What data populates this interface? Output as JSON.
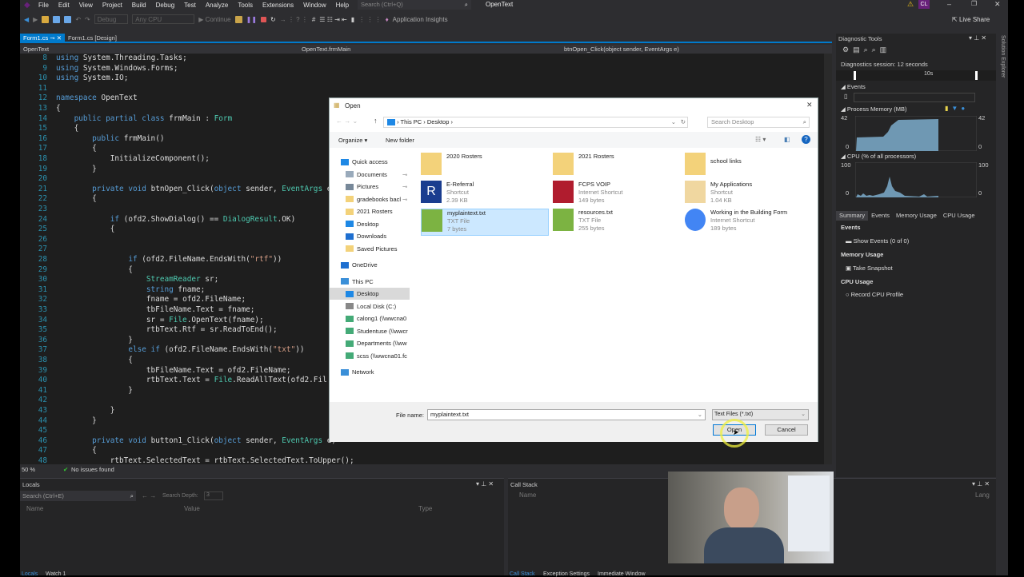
{
  "menu": [
    "File",
    "Edit",
    "View",
    "Project",
    "Build",
    "Debug",
    "Test",
    "Analyze",
    "Tools",
    "Extensions",
    "Window",
    "Help"
  ],
  "search_placeholder": "Search (Ctrl+Q)",
  "solution_name": "OpenText",
  "user_initials": "CL",
  "toolbar": {
    "config": "Debug",
    "platform": "Any CPU",
    "continue": "Continue",
    "app_insights": "Application Insights",
    "live_share": "Live Share"
  },
  "tabs": [
    {
      "label": "Form1.cs",
      "active": true
    },
    {
      "label": "Form1.cs [Design]",
      "active": false
    }
  ],
  "navbar": {
    "project": "OpenText",
    "class": "OpenText.frmMain",
    "member": "btnOpen_Click(object sender, EventArgs e)"
  },
  "code": [
    {
      "n": "8",
      "t": "using System.Threading.Tasks;"
    },
    {
      "n": "9",
      "t": "using System.Windows.Forms;"
    },
    {
      "n": "10",
      "t": "using System.IO;"
    },
    {
      "n": "11",
      "t": ""
    },
    {
      "n": "12",
      "t": "namespace OpenText"
    },
    {
      "n": "13",
      "t": "{"
    },
    {
      "n": "14",
      "t": "    public partial class frmMain : Form"
    },
    {
      "n": "15",
      "t": "    {"
    },
    {
      "n": "16",
      "t": "        public frmMain()"
    },
    {
      "n": "17",
      "t": "        {"
    },
    {
      "n": "18",
      "t": "            InitializeComponent();"
    },
    {
      "n": "19",
      "t": "        }"
    },
    {
      "n": "20",
      "t": ""
    },
    {
      "n": "21",
      "t": "        private void btnOpen_Click(object sender, EventArgs e)"
    },
    {
      "n": "22",
      "t": "        {"
    },
    {
      "n": "23",
      "t": ""
    },
    {
      "n": "24",
      "t": "            if (ofd2.ShowDialog() == DialogResult.OK)"
    },
    {
      "n": "25",
      "t": "            {"
    },
    {
      "n": "26",
      "t": ""
    },
    {
      "n": "27",
      "t": ""
    },
    {
      "n": "28",
      "t": "                if (ofd2.FileName.EndsWith(\"rtf\"))"
    },
    {
      "n": "29",
      "t": "                {"
    },
    {
      "n": "30",
      "t": "                    StreamReader sr;"
    },
    {
      "n": "31",
      "t": "                    string fname;"
    },
    {
      "n": "32",
      "t": "                    fname = ofd2.FileName;"
    },
    {
      "n": "33",
      "t": "                    tbFileName.Text = fname;"
    },
    {
      "n": "34",
      "t": "                    sr = File.OpenText(fname);"
    },
    {
      "n": "35",
      "t": "                    rtbText.Rtf = sr.ReadToEnd();"
    },
    {
      "n": "36",
      "t": "                }"
    },
    {
      "n": "37",
      "t": "                else if (ofd2.FileName.EndsWith(\"txt\"))"
    },
    {
      "n": "38",
      "t": "                {"
    },
    {
      "n": "39",
      "t": "                    tbFileName.Text = ofd2.FileName;"
    },
    {
      "n": "40",
      "t": "                    rtbText.Text = File.ReadAllText(ofd2.Fil"
    },
    {
      "n": "41",
      "t": "                }"
    },
    {
      "n": "42",
      "t": ""
    },
    {
      "n": "43",
      "t": "            }"
    },
    {
      "n": "44",
      "t": "        }"
    },
    {
      "n": "45",
      "t": ""
    },
    {
      "n": "46",
      "t": "        private void button1_Click(object sender, EventArgs e)"
    },
    {
      "n": "47",
      "t": "        {"
    },
    {
      "n": "48",
      "t": "            rtbText.SelectedText = rtbText.SelectedText.ToUpper();"
    }
  ],
  "status": {
    "zoom": "50 %",
    "issues": "No issues found"
  },
  "locals": {
    "title": "Locals",
    "search_placeholder": "Search (Ctrl+E)",
    "search_depth_label": "Search Depth:",
    "search_depth": "3",
    "columns": [
      "Name",
      "Value",
      "Type"
    ],
    "tabs": [
      "Locals",
      "Watch 1"
    ]
  },
  "callstack": {
    "title": "Call Stack",
    "columns": [
      "Name",
      "Lang"
    ],
    "tabs": [
      "Call Stack",
      "Exception Settings",
      "Immediate Window"
    ]
  },
  "diag": {
    "title": "Diagnostic Tools",
    "session": "Diagnostics session: 12 seconds",
    "timeline": "10s",
    "events": "Events",
    "memory": "Process Memory (MB)",
    "mem_max": "42",
    "mem_min": "0",
    "cpu": "CPU (% of all processors)",
    "cpu_max": "100",
    "cpu_min": "0",
    "tabs": [
      "Summary",
      "Events",
      "Memory Usage",
      "CPU Usage"
    ],
    "sections": [
      {
        "title": "Events",
        "action": "Show Events (0 of 0)"
      },
      {
        "title": "Memory Usage",
        "action": "Take Snapshot"
      },
      {
        "title": "CPU Usage",
        "action": "Record CPU Profile"
      }
    ]
  },
  "solution_explorer": "Solution Explorer",
  "dialog": {
    "title": "Open",
    "breadcrumb": [
      "This PC",
      "Desktop"
    ],
    "search_placeholder": "Search Desktop",
    "organize": "Organize",
    "new_folder": "New folder",
    "nav": [
      {
        "label": "Quick access",
        "level": 0,
        "icon": "star"
      },
      {
        "label": "Documents",
        "level": 1,
        "icon": "doc",
        "pin": true
      },
      {
        "label": "Pictures",
        "level": 1,
        "icon": "pic",
        "pin": true
      },
      {
        "label": "gradebooks bacl",
        "level": 1,
        "icon": "folder",
        "pin": true
      },
      {
        "label": "2021 Rosters",
        "level": 1,
        "icon": "folder"
      },
      {
        "label": "Desktop",
        "level": 1,
        "icon": "desktop"
      },
      {
        "label": "Downloads",
        "level": 1,
        "icon": "download"
      },
      {
        "label": "Saved Pictures",
        "level": 1,
        "icon": "folder"
      },
      {
        "label": "OneDrive",
        "level": 0,
        "icon": "cloud",
        "gap": true
      },
      {
        "label": "This PC",
        "level": 0,
        "icon": "pc",
        "gap": true
      },
      {
        "label": "Desktop",
        "level": 1,
        "icon": "desktop",
        "selected": true
      },
      {
        "label": "Local Disk (C:)",
        "level": 1,
        "icon": "disk"
      },
      {
        "label": "calong1 (\\\\wwcna0",
        "level": 1,
        "icon": "net"
      },
      {
        "label": "Studentuse (\\\\wwcr",
        "level": 1,
        "icon": "net"
      },
      {
        "label": "Departments (\\\\ww",
        "level": 1,
        "icon": "net"
      },
      {
        "label": "scss (\\\\wwcna01.fc",
        "level": 1,
        "icon": "net"
      },
      {
        "label": "Network",
        "level": 0,
        "icon": "network",
        "gap": true
      }
    ],
    "files": [
      {
        "name": "2020 Rosters",
        "type": "",
        "size": "",
        "icon": "folder-doc"
      },
      {
        "name": "2021 Rosters",
        "type": "",
        "size": "",
        "icon": "folder-doc"
      },
      {
        "name": "school links",
        "type": "",
        "size": "",
        "icon": "folder"
      },
      {
        "name": "E-Referral",
        "type": "Shortcut",
        "size": "2.39 KB",
        "icon": "r-app"
      },
      {
        "name": "FCPS VOIP",
        "type": "Internet Shortcut",
        "size": "149 bytes",
        "icon": "phone"
      },
      {
        "name": "My Applications",
        "type": "Shortcut",
        "size": "1.04 KB",
        "icon": "app"
      },
      {
        "name": "myplaintext.txt",
        "type": "TXT File",
        "size": "7 bytes",
        "icon": "txt",
        "selected": true
      },
      {
        "name": "resources.txt",
        "type": "TXT File",
        "size": "255 bytes",
        "icon": "txt"
      },
      {
        "name": "Working in the Building Form",
        "type": "Internet Shortcut",
        "size": "189 bytes",
        "icon": "chrome"
      }
    ],
    "filename_label": "File name:",
    "filename": "myplaintext.txt",
    "filter": "Text Files (*.txt)",
    "open": "Open",
    "cancel": "Cancel"
  }
}
